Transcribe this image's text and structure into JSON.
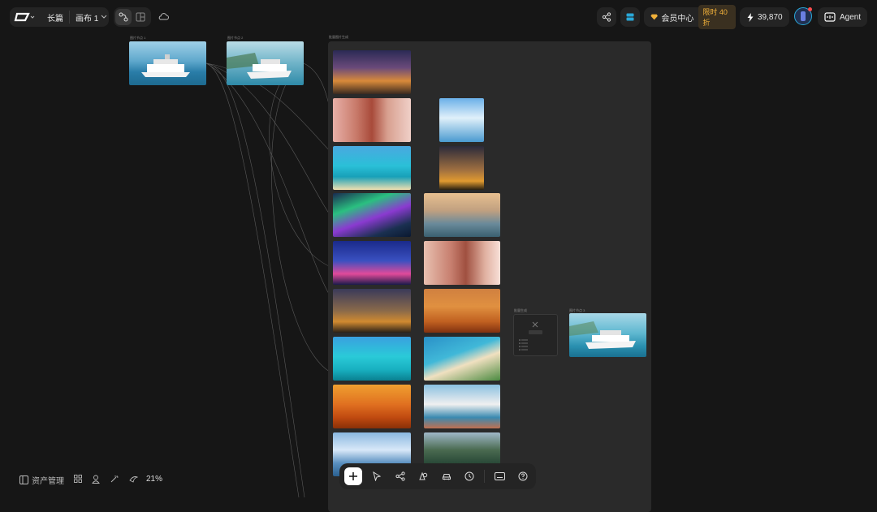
{
  "header": {
    "project_name": "长篇",
    "canvas_name": "画布 1",
    "member_center": "会员中心",
    "member_badge": "限时 40 折",
    "credits": "39,870",
    "agent_label": "Agent"
  },
  "canvas": {
    "zoom": "21%",
    "nodes": [
      {
        "label": "图片节点 1"
      },
      {
        "label": "图片节点 2"
      },
      {
        "label": "批量图片生成"
      },
      {
        "label": "批量生成"
      },
      {
        "label": "图片节点 3"
      },
      {
        "label": "拼接图片"
      }
    ]
  },
  "bottom_left": {
    "assets_label": "资产管理"
  },
  "colors": {
    "background": "#161616",
    "panel": "#242424",
    "accent_cyan": "#2aa8d8",
    "badge_gold": "#f0b03a"
  }
}
